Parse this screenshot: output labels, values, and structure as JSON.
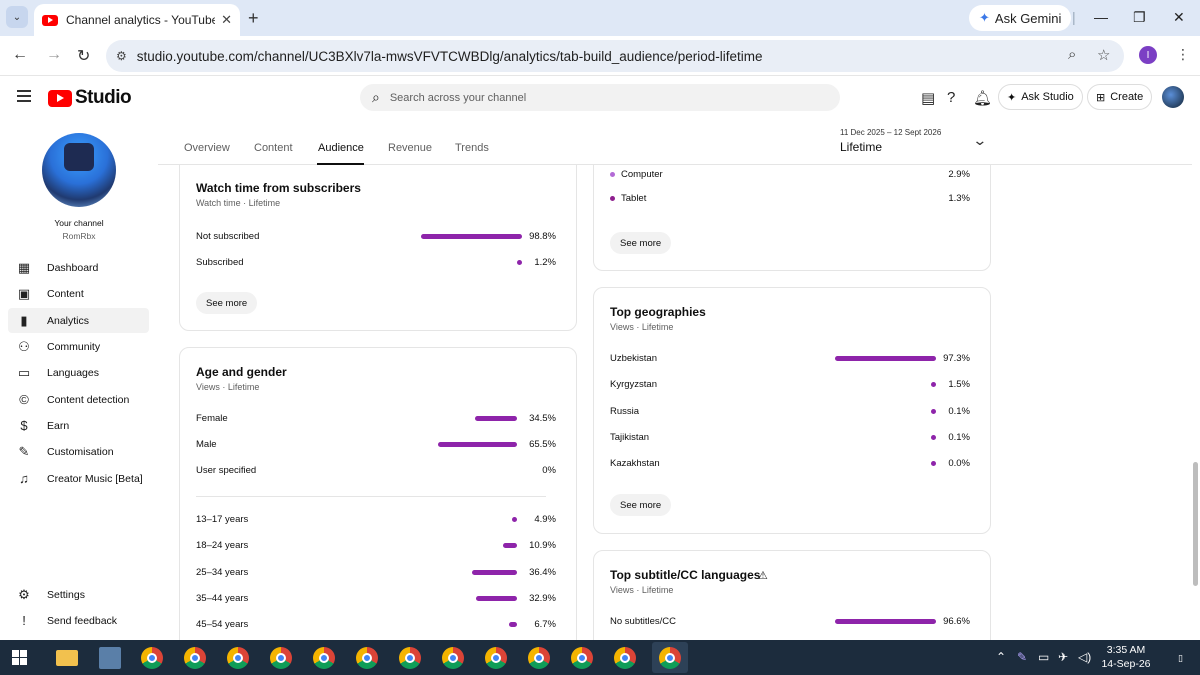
{
  "browser": {
    "tab_title": "Channel analytics - YouTube Stu",
    "new_tab": "+",
    "ask_gemini": "Ask Gemini",
    "url": "studio.youtube.com/channel/UC3BXlv7la-mwsVFVTCWBDlg/analytics/tab-build_audience/period-lifetime",
    "profile_initial": "I"
  },
  "header": {
    "logo_text": "Studio",
    "search_placeholder": "Search across your channel",
    "ask_studio": "Ask Studio",
    "create": "Create"
  },
  "sidebar": {
    "channel_label": "Your channel",
    "channel_name": "RomRbx",
    "items": [
      {
        "label": "Dashboard",
        "icon": "dashboard-icon"
      },
      {
        "label": "Content",
        "icon": "content-icon"
      },
      {
        "label": "Analytics",
        "icon": "analytics-icon"
      },
      {
        "label": "Community",
        "icon": "community-icon"
      },
      {
        "label": "Languages",
        "icon": "languages-icon"
      },
      {
        "label": "Content detection",
        "icon": "copyright-icon"
      },
      {
        "label": "Earn",
        "icon": "earn-icon"
      },
      {
        "label": "Customisation",
        "icon": "customisation-icon"
      },
      {
        "label": "Creator Music [Beta]",
        "icon": "music-icon"
      }
    ],
    "footer_items": [
      {
        "label": "Settings",
        "icon": "gear-icon"
      },
      {
        "label": "Send feedback",
        "icon": "feedback-icon"
      }
    ]
  },
  "subnav": {
    "tabs": [
      "Overview",
      "Content",
      "Audience",
      "Revenue",
      "Trends"
    ],
    "active_tab": "Audience",
    "period_range": "11 Dec 2025 – 12 Sept 2026",
    "period_value": "Lifetime"
  },
  "cards": {
    "watch_time": {
      "title": "Watch time from subscribers",
      "subtitle": "Watch time · Lifetime",
      "rows": [
        {
          "label": "Not subscribed",
          "value": "98.8%",
          "pct": 98.8
        },
        {
          "label": "Subscribed",
          "value": "1.2%",
          "pct": 1.2
        }
      ],
      "see_more": "See more"
    },
    "age_gender": {
      "title": "Age and gender",
      "subtitle": "Views · Lifetime",
      "gender_rows": [
        {
          "label": "Female",
          "value": "34.5%",
          "pct": 34.5
        },
        {
          "label": "Male",
          "value": "65.5%",
          "pct": 65.5
        },
        {
          "label": "User specified",
          "value": "0%",
          "pct": 0
        }
      ],
      "age_rows": [
        {
          "label": "13–17 years",
          "value": "4.9%",
          "pct": 4.9
        },
        {
          "label": "18–24 years",
          "value": "10.9%",
          "pct": 10.9
        },
        {
          "label": "25–34 years",
          "value": "36.4%",
          "pct": 36.4
        },
        {
          "label": "35–44 years",
          "value": "32.9%",
          "pct": 32.9
        },
        {
          "label": "45–54 years",
          "value": "6.7%",
          "pct": 6.7
        }
      ]
    },
    "device_type": {
      "rows": [
        {
          "label": "Computer",
          "value": "2.9%",
          "color": "#b36ad6"
        },
        {
          "label": "Tablet",
          "value": "1.3%",
          "color": "#8e1f8e"
        }
      ],
      "see_more": "See more"
    },
    "geographies": {
      "title": "Top geographies",
      "subtitle": "Views · Lifetime",
      "rows": [
        {
          "label": "Uzbekistan",
          "value": "97.3%",
          "pct": 97.3
        },
        {
          "label": "Kyrgyzstan",
          "value": "1.5%",
          "pct": 1.5
        },
        {
          "label": "Russia",
          "value": "0.1%",
          "pct": 0.1
        },
        {
          "label": "Tajikistan",
          "value": "0.1%",
          "pct": 0.1
        },
        {
          "label": "Kazakhstan",
          "value": "0.0%",
          "pct": 0.0
        }
      ],
      "see_more": "See more"
    },
    "subtitles": {
      "title": "Top subtitle/CC languages",
      "subtitle": "Views · Lifetime",
      "rows": [
        {
          "label": "No subtitles/CC",
          "value": "96.6%",
          "pct": 96.6
        }
      ]
    }
  },
  "taskbar": {
    "time": "3:35 AM",
    "date": "14-Sep-26"
  },
  "colors": {
    "bar": "#8e24aa",
    "brand": "#ff0000"
  }
}
